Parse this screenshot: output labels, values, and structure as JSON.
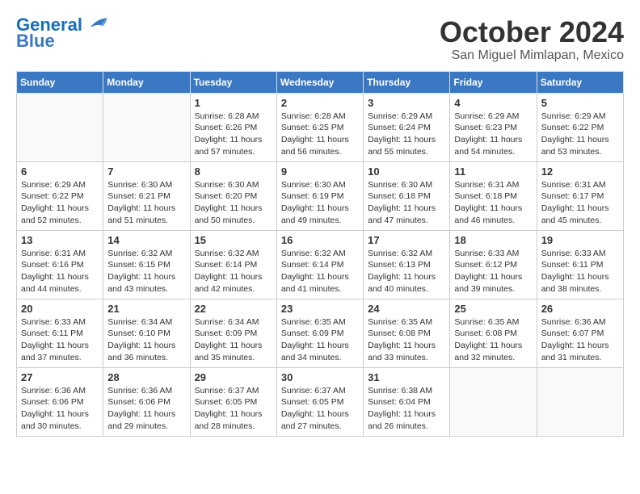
{
  "header": {
    "logo_line1": "General",
    "logo_line2": "Blue",
    "month": "October 2024",
    "location": "San Miguel Mimlapan, Mexico"
  },
  "weekdays": [
    "Sunday",
    "Monday",
    "Tuesday",
    "Wednesday",
    "Thursday",
    "Friday",
    "Saturday"
  ],
  "weeks": [
    [
      {
        "day": "",
        "info": ""
      },
      {
        "day": "",
        "info": ""
      },
      {
        "day": "1",
        "info": "Sunrise: 6:28 AM\nSunset: 6:26 PM\nDaylight: 11 hours and 57 minutes."
      },
      {
        "day": "2",
        "info": "Sunrise: 6:28 AM\nSunset: 6:25 PM\nDaylight: 11 hours and 56 minutes."
      },
      {
        "day": "3",
        "info": "Sunrise: 6:29 AM\nSunset: 6:24 PM\nDaylight: 11 hours and 55 minutes."
      },
      {
        "day": "4",
        "info": "Sunrise: 6:29 AM\nSunset: 6:23 PM\nDaylight: 11 hours and 54 minutes."
      },
      {
        "day": "5",
        "info": "Sunrise: 6:29 AM\nSunset: 6:22 PM\nDaylight: 11 hours and 53 minutes."
      }
    ],
    [
      {
        "day": "6",
        "info": "Sunrise: 6:29 AM\nSunset: 6:22 PM\nDaylight: 11 hours and 52 minutes."
      },
      {
        "day": "7",
        "info": "Sunrise: 6:30 AM\nSunset: 6:21 PM\nDaylight: 11 hours and 51 minutes."
      },
      {
        "day": "8",
        "info": "Sunrise: 6:30 AM\nSunset: 6:20 PM\nDaylight: 11 hours and 50 minutes."
      },
      {
        "day": "9",
        "info": "Sunrise: 6:30 AM\nSunset: 6:19 PM\nDaylight: 11 hours and 49 minutes."
      },
      {
        "day": "10",
        "info": "Sunrise: 6:30 AM\nSunset: 6:18 PM\nDaylight: 11 hours and 47 minutes."
      },
      {
        "day": "11",
        "info": "Sunrise: 6:31 AM\nSunset: 6:18 PM\nDaylight: 11 hours and 46 minutes."
      },
      {
        "day": "12",
        "info": "Sunrise: 6:31 AM\nSunset: 6:17 PM\nDaylight: 11 hours and 45 minutes."
      }
    ],
    [
      {
        "day": "13",
        "info": "Sunrise: 6:31 AM\nSunset: 6:16 PM\nDaylight: 11 hours and 44 minutes."
      },
      {
        "day": "14",
        "info": "Sunrise: 6:32 AM\nSunset: 6:15 PM\nDaylight: 11 hours and 43 minutes."
      },
      {
        "day": "15",
        "info": "Sunrise: 6:32 AM\nSunset: 6:14 PM\nDaylight: 11 hours and 42 minutes."
      },
      {
        "day": "16",
        "info": "Sunrise: 6:32 AM\nSunset: 6:14 PM\nDaylight: 11 hours and 41 minutes."
      },
      {
        "day": "17",
        "info": "Sunrise: 6:32 AM\nSunset: 6:13 PM\nDaylight: 11 hours and 40 minutes."
      },
      {
        "day": "18",
        "info": "Sunrise: 6:33 AM\nSunset: 6:12 PM\nDaylight: 11 hours and 39 minutes."
      },
      {
        "day": "19",
        "info": "Sunrise: 6:33 AM\nSunset: 6:11 PM\nDaylight: 11 hours and 38 minutes."
      }
    ],
    [
      {
        "day": "20",
        "info": "Sunrise: 6:33 AM\nSunset: 6:11 PM\nDaylight: 11 hours and 37 minutes."
      },
      {
        "day": "21",
        "info": "Sunrise: 6:34 AM\nSunset: 6:10 PM\nDaylight: 11 hours and 36 minutes."
      },
      {
        "day": "22",
        "info": "Sunrise: 6:34 AM\nSunset: 6:09 PM\nDaylight: 11 hours and 35 minutes."
      },
      {
        "day": "23",
        "info": "Sunrise: 6:35 AM\nSunset: 6:09 PM\nDaylight: 11 hours and 34 minutes."
      },
      {
        "day": "24",
        "info": "Sunrise: 6:35 AM\nSunset: 6:08 PM\nDaylight: 11 hours and 33 minutes."
      },
      {
        "day": "25",
        "info": "Sunrise: 6:35 AM\nSunset: 6:08 PM\nDaylight: 11 hours and 32 minutes."
      },
      {
        "day": "26",
        "info": "Sunrise: 6:36 AM\nSunset: 6:07 PM\nDaylight: 11 hours and 31 minutes."
      }
    ],
    [
      {
        "day": "27",
        "info": "Sunrise: 6:36 AM\nSunset: 6:06 PM\nDaylight: 11 hours and 30 minutes."
      },
      {
        "day": "28",
        "info": "Sunrise: 6:36 AM\nSunset: 6:06 PM\nDaylight: 11 hours and 29 minutes."
      },
      {
        "day": "29",
        "info": "Sunrise: 6:37 AM\nSunset: 6:05 PM\nDaylight: 11 hours and 28 minutes."
      },
      {
        "day": "30",
        "info": "Sunrise: 6:37 AM\nSunset: 6:05 PM\nDaylight: 11 hours and 27 minutes."
      },
      {
        "day": "31",
        "info": "Sunrise: 6:38 AM\nSunset: 6:04 PM\nDaylight: 11 hours and 26 minutes."
      },
      {
        "day": "",
        "info": ""
      },
      {
        "day": "",
        "info": ""
      }
    ]
  ]
}
